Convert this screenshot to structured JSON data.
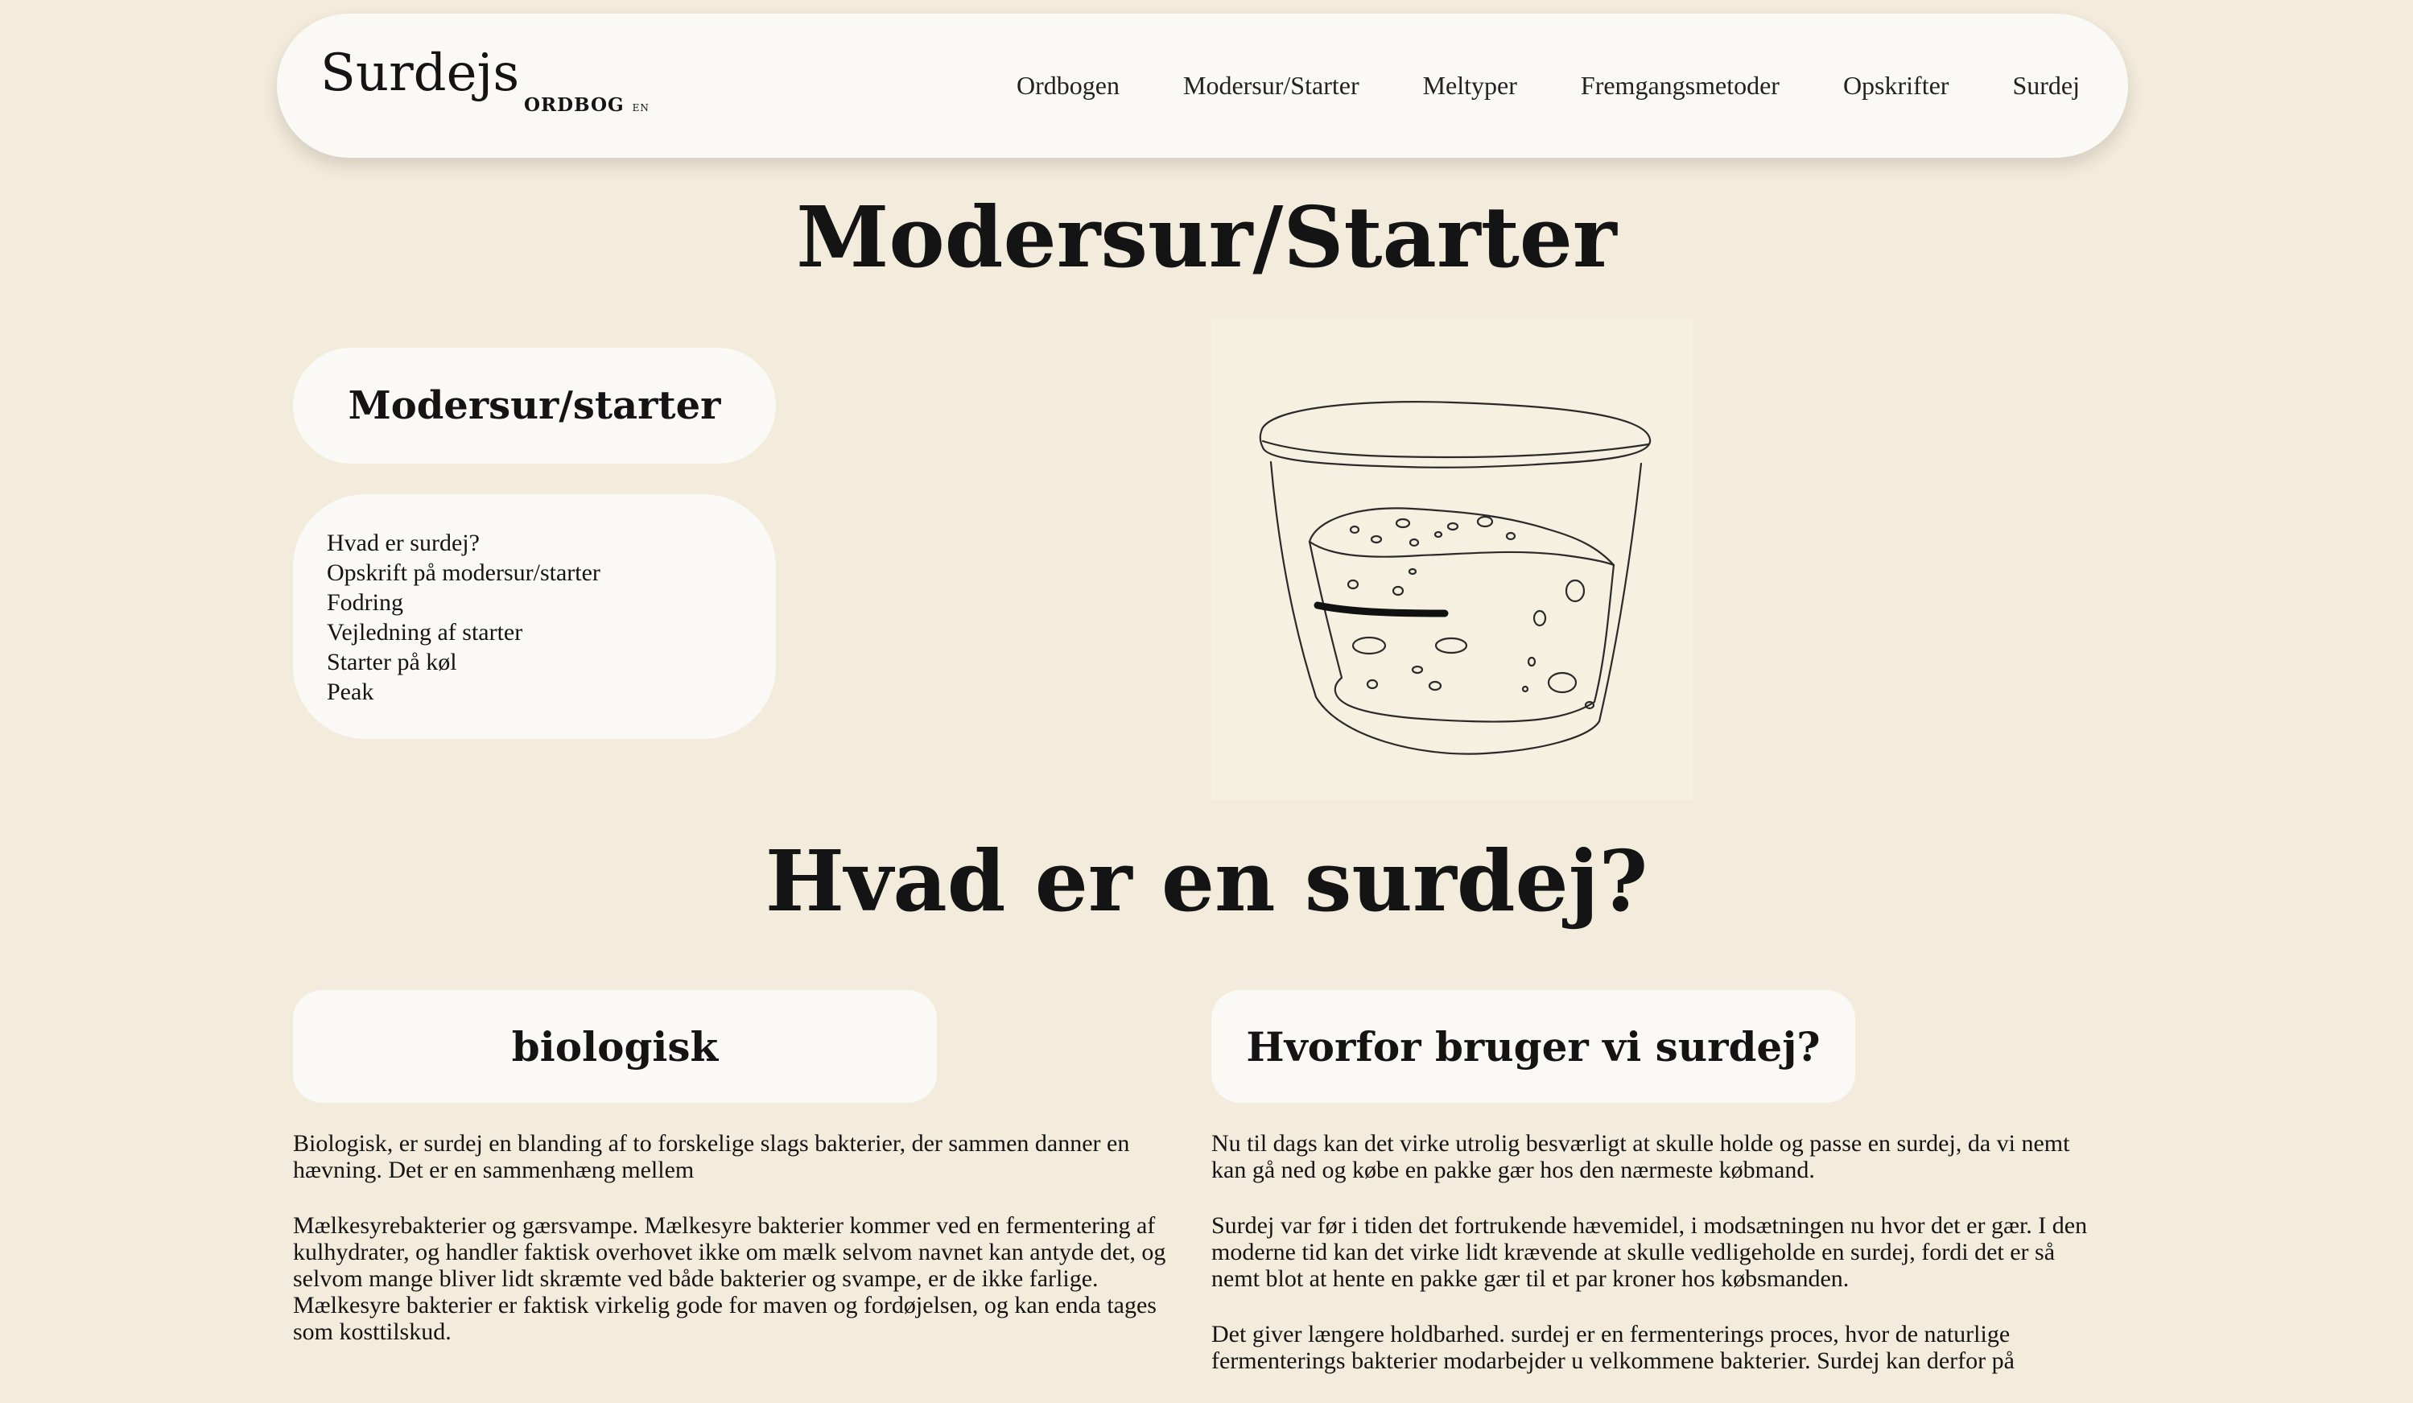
{
  "header": {
    "logo": "Surdejs",
    "logo_sub": "ORDBOG",
    "logo_lang": "EN",
    "nav": [
      "Ordbogen",
      "Modersur/Starter",
      "Meltyper",
      "Fremgangsmetoder",
      "Opskrifter",
      "Surdej"
    ]
  },
  "page": {
    "title": "Modersur/Starter"
  },
  "sidebar": {
    "title": "Modersur/starter",
    "toc": [
      "Hvad er surdej?",
      "Opskrift på modersur/starter",
      "Fodring",
      "Vejledning af starter",
      "Starter på køl",
      "Peak"
    ]
  },
  "illustration": {
    "icon": "sourdough-starter-jar-icon"
  },
  "section": {
    "title": "Hvad er en surdej?",
    "left": {
      "heading": "biologisk",
      "paragraphs": [
        "Biologisk, er surdej en blanding af to forskelige slags bakterier, der sammen danner en hævning. Det er en sammenhæng mellem",
        "Mælkesyrebakterier og gærsvampe. Mælkesyre bakterier kommer ved en fermentering af kulhydrater, og handler faktisk overhovet ikke om mælk selvom navnet kan antyde det, og selvom mange bliver lidt skræmte ved både bakterier og svampe, er de ikke farlige. Mælkesyre bakterier er faktisk virkelig gode for maven og fordøjelsen, og kan enda tages som kosttilskud."
      ]
    },
    "right": {
      "heading": "Hvorfor bruger vi surdej?",
      "paragraphs": [
        "Nu til dags kan det virke utrolig besværligt at skulle holde og passe en surdej, da vi nemt kan gå ned og købe en pakke gær hos den nærmeste købmand.",
        "Surdej var før i tiden det fortrukende hævemidel, i modsætningen nu hvor det er gær. I den moderne tid kan det virke lidt krævende at skulle vedligeholde en surdej, fordi det er så nemt blot at hente en pakke gær til et par kroner hos købsmanden.",
        "Det giver længere holdbarhed. surdej er en fermenterings proces, hvor de naturlige fermenterings bakterier modarbejder u velkommene bakterier. Surdej kan derfor på"
      ]
    }
  }
}
